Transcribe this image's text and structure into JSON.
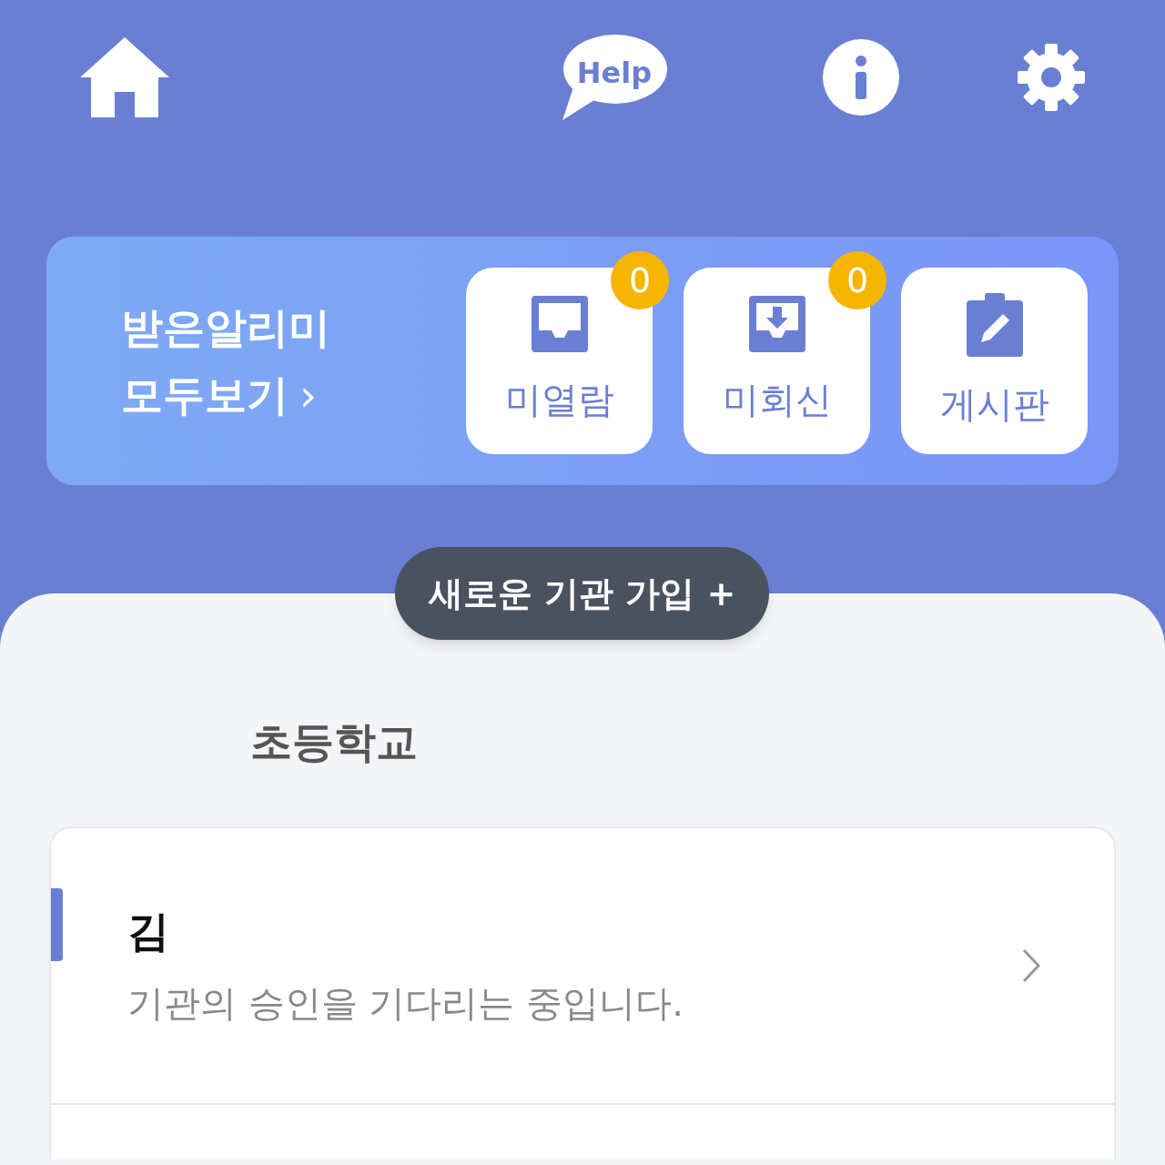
{
  "top_bar": {
    "help_label": "Help"
  },
  "alerts": {
    "title_line1": "받은알리미",
    "title_line2": "모두보기",
    "arrow": "›",
    "buttons": [
      {
        "kind": "inbox",
        "label": "미열람",
        "badge": "0"
      },
      {
        "kind": "download",
        "label": "미회신",
        "badge": "0"
      },
      {
        "kind": "board",
        "label": "게시판"
      }
    ]
  },
  "join_button": {
    "label": "새로운 기관 가입 +"
  },
  "school": {
    "name": "초등학교"
  },
  "members": [
    {
      "name": "김",
      "status": "기관의 승인을 기다리는 중입니다.",
      "selected": true
    }
  ]
}
